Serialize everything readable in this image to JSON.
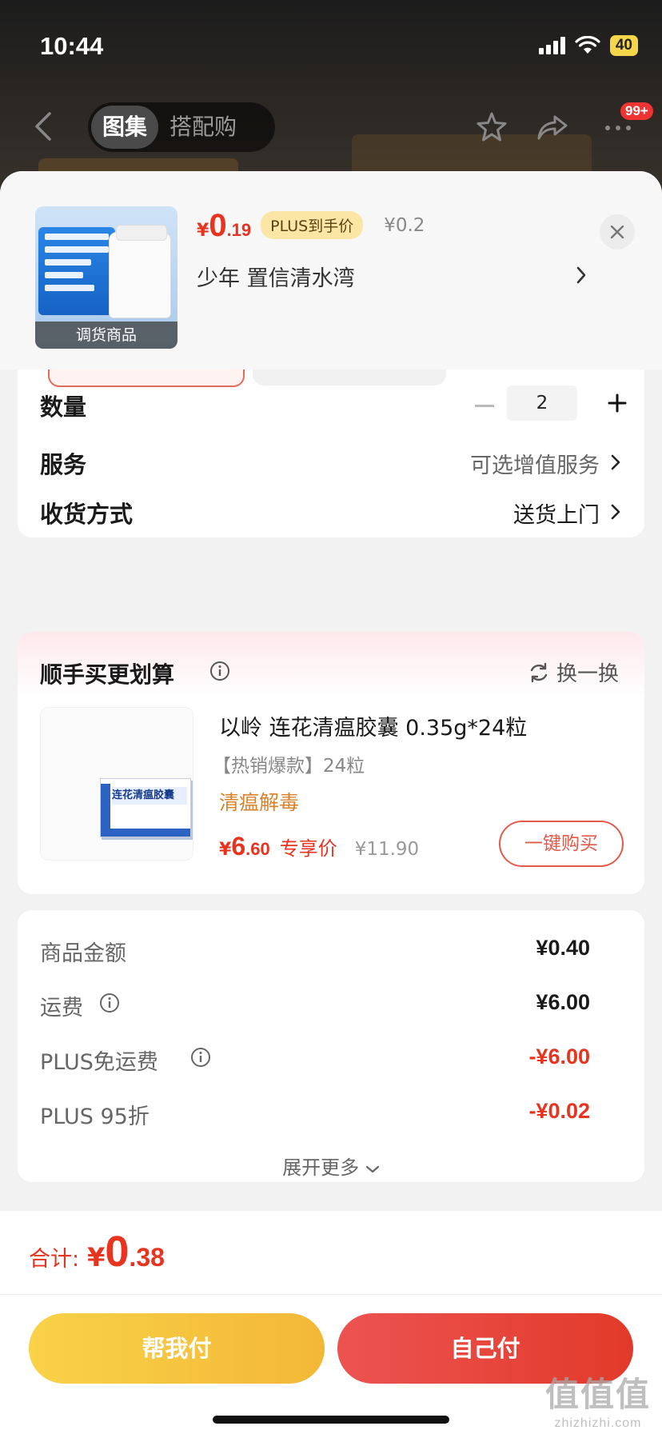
{
  "status_bar": {
    "time": "10:44",
    "battery": "40"
  },
  "nav": {
    "tabs": [
      "图集",
      "搭配购"
    ],
    "badge": "99+"
  },
  "product": {
    "thumb_label": "调货商品",
    "price_yen": "¥",
    "price_int": "0",
    "price_dec": ".19",
    "plus_tag": "PLUS到手价",
    "orig_price": "¥0.2",
    "address": "少年  置信清水湾"
  },
  "options": {
    "quantity_label": "数量",
    "quantity_value": "2",
    "service_label": "服务",
    "service_value": "可选增值服务",
    "delivery_label": "收货方式",
    "delivery_value": "送货上门"
  },
  "recommend": {
    "title": "顺手买更划算",
    "swap_label": "换一换",
    "box_title": "连花清瘟胶囊",
    "name": "以岭 连花清瘟胶囊 0.35g*24粒",
    "tag": "【热销爆款】24粒",
    "effect": "清瘟解毒",
    "price_yen": "¥",
    "price_int": "6",
    "price_dec": ".60",
    "price_label": "专享价",
    "orig_price": "¥11.90",
    "buy_label": "一键购买"
  },
  "fees": [
    {
      "label": "商品金额",
      "value": "¥0.40",
      "info": false,
      "negative": false
    },
    {
      "label": "运费",
      "value": "¥6.00",
      "info": true,
      "negative": false
    },
    {
      "label": "PLUS免运费",
      "value": "-¥6.00",
      "info": true,
      "negative": true
    },
    {
      "label": "PLUS 95折",
      "value": "-¥0.02",
      "info": false,
      "negative": true
    }
  ],
  "expand_label": "展开更多",
  "total": {
    "label": "合计:",
    "yen": "¥",
    "int": "0",
    "dec": ".38"
  },
  "actions": {
    "help_pay": "帮我付",
    "self_pay": "自己付"
  },
  "watermark": {
    "big": "值值值",
    "small": "zhizhizhi.com"
  },
  "colors": {
    "accent_red": "#e8331f",
    "plus_gold": "#fbe6a6",
    "help_yellow": "#f9d248"
  }
}
